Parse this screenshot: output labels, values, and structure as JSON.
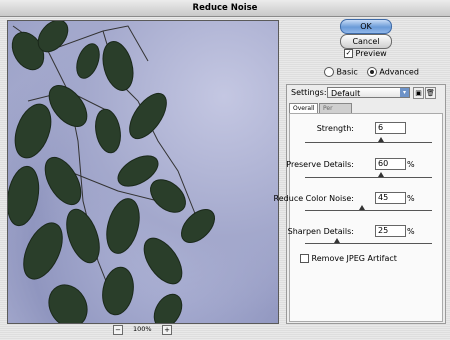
{
  "window": {
    "title": "Reduce Noise"
  },
  "buttons": {
    "ok": "OK",
    "cancel": "Cancel"
  },
  "preview": {
    "label": "Preview",
    "checked": true
  },
  "mode": {
    "basic": "Basic",
    "advanced": "Advanced",
    "selected": "Advanced"
  },
  "settings": {
    "label": "Settings:",
    "value": "Default"
  },
  "tabs": [
    {
      "label": "Overall",
      "active": true
    },
    {
      "label": "Per Channel",
      "active": false
    }
  ],
  "controls": [
    {
      "label": "Strength:",
      "value": "6",
      "unit": "",
      "fraction": 0.6
    },
    {
      "label": "Preserve Details:",
      "value": "60",
      "unit": "%",
      "fraction": 0.6
    },
    {
      "label": "Reduce Color Noise:",
      "value": "45",
      "unit": "%",
      "fraction": 0.45
    },
    {
      "label": "Sharpen Details:",
      "value": "25",
      "unit": "%",
      "fraction": 0.25
    }
  ],
  "remove_jpeg": {
    "label": "Remove JPEG Artifact",
    "checked": false
  },
  "zoom": {
    "level": "100%",
    "minus": "−",
    "plus": "+"
  },
  "colors": {
    "accent": "#6b9bd8",
    "leaf": "#2a3e2a",
    "sky": "#a3a8cc"
  }
}
